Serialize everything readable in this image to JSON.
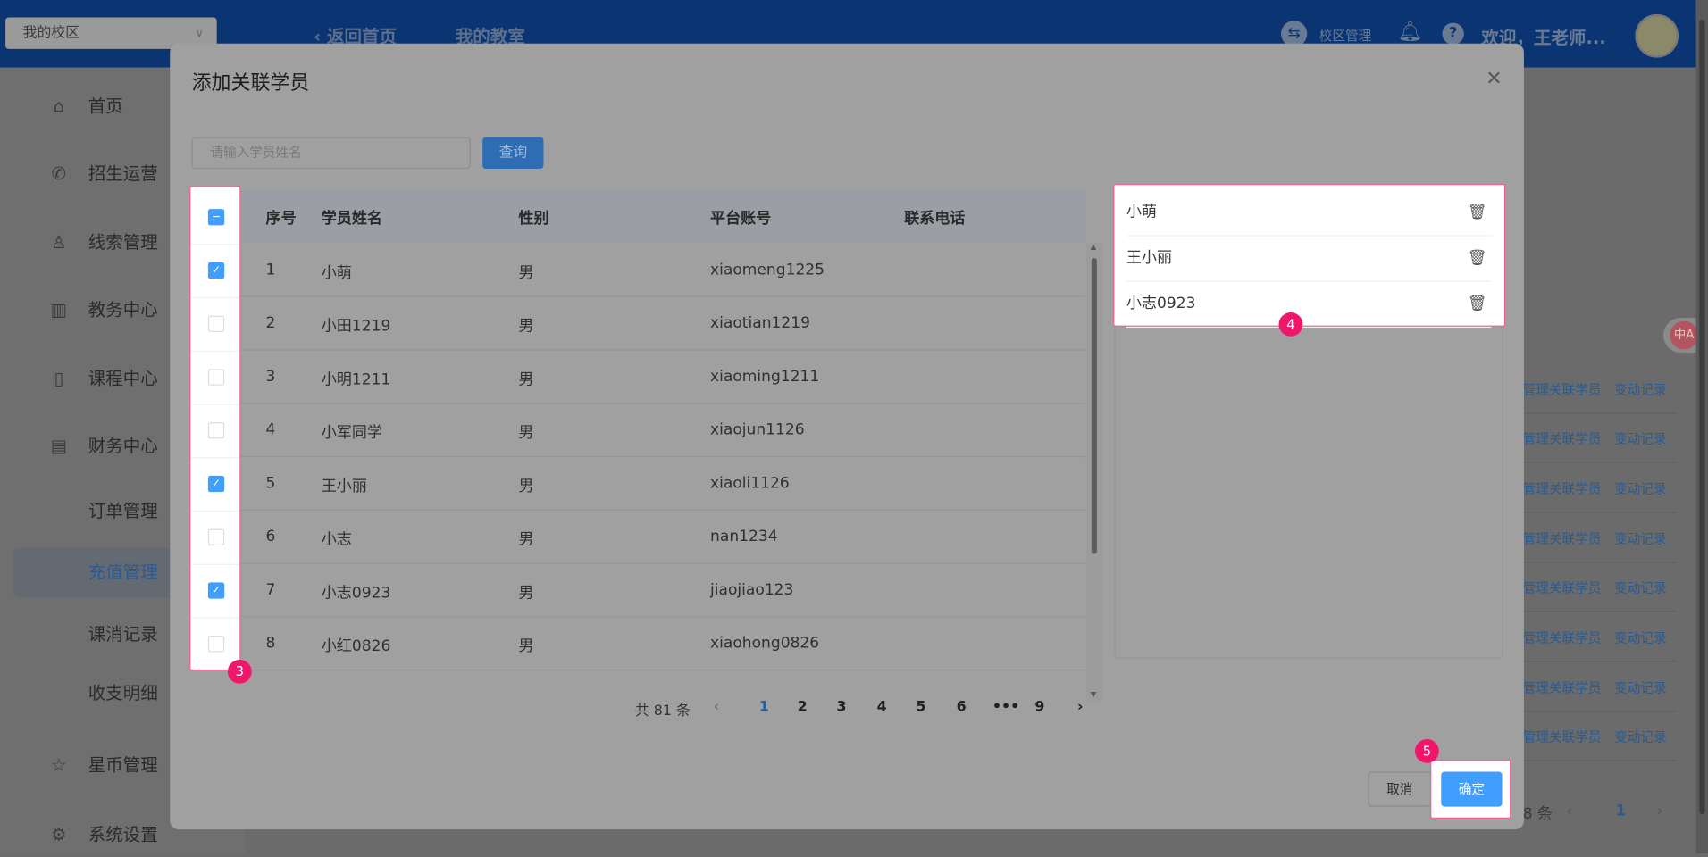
{
  "header": {
    "campus_select": "我的校区",
    "back_home": "返回首页",
    "my_classroom": "我的教室",
    "campus_manage": "校区管理",
    "welcome": "欢迎，王老师..."
  },
  "sidebar": {
    "items": [
      {
        "label": "首页",
        "icon": "home-icon"
      },
      {
        "label": "招生运营",
        "icon": "phone-icon"
      },
      {
        "label": "线索管理",
        "icon": "user-icon"
      },
      {
        "label": "教务中心",
        "icon": "building-icon"
      },
      {
        "label": "课程中心",
        "icon": "notebook-icon"
      },
      {
        "label": "财务中心",
        "icon": "card-icon"
      },
      {
        "label": "订单管理"
      },
      {
        "label": "充值管理",
        "active": true
      },
      {
        "label": "课消记录"
      },
      {
        "label": "收支明细"
      },
      {
        "label": "星币管理",
        "icon": "star-icon"
      },
      {
        "label": "系统设置",
        "icon": "gear-icon"
      }
    ]
  },
  "background": {
    "link_manage": "管理关联学员",
    "link_changes": "变动记录",
    "total_partial": "8 条",
    "current_page": "1"
  },
  "modal": {
    "title": "添加关联学员",
    "search_placeholder": "请输入学员姓名",
    "search_button": "查询",
    "columns": [
      "序号",
      "学员姓名",
      "性别",
      "平台账号",
      "联系电话"
    ],
    "rows": [
      {
        "no": "1",
        "name": "小萌",
        "gender": "男",
        "account": "xiaomeng1225",
        "phone": "",
        "checked": true
      },
      {
        "no": "2",
        "name": "小田1219",
        "gender": "男",
        "account": "xiaotian1219",
        "phone": "",
        "checked": false
      },
      {
        "no": "3",
        "name": "小明1211",
        "gender": "男",
        "account": "xiaoming1211",
        "phone": "",
        "checked": false
      },
      {
        "no": "4",
        "name": "小军同学",
        "gender": "男",
        "account": "xiaojun1126",
        "phone": "",
        "checked": false
      },
      {
        "no": "5",
        "name": "王小丽",
        "gender": "男",
        "account": "xiaoli1126",
        "phone": "",
        "checked": true
      },
      {
        "no": "6",
        "name": "小志",
        "gender": "男",
        "account": "nan1234",
        "phone": "",
        "checked": false
      },
      {
        "no": "7",
        "name": "小志0923",
        "gender": "男",
        "account": "jiaojiao123",
        "phone": "",
        "checked": true
      },
      {
        "no": "8",
        "name": "小红0826",
        "gender": "男",
        "account": "xiaohong0826",
        "phone": "",
        "checked": false
      }
    ],
    "selected": [
      "小萌",
      "王小丽",
      "小志0923"
    ],
    "pagination": {
      "total": "共 81 条",
      "pages": [
        "1",
        "2",
        "3",
        "4",
        "5",
        "6",
        "•••",
        "9"
      ],
      "current": "1"
    },
    "cancel": "取消",
    "confirm": "确定"
  },
  "annotations": {
    "step3": "3",
    "step4": "4",
    "step5": "5"
  },
  "colors": {
    "primary": "#409eff",
    "highlight": "#ef5f90",
    "badge": "#f0166c",
    "header": "#0b3572"
  }
}
